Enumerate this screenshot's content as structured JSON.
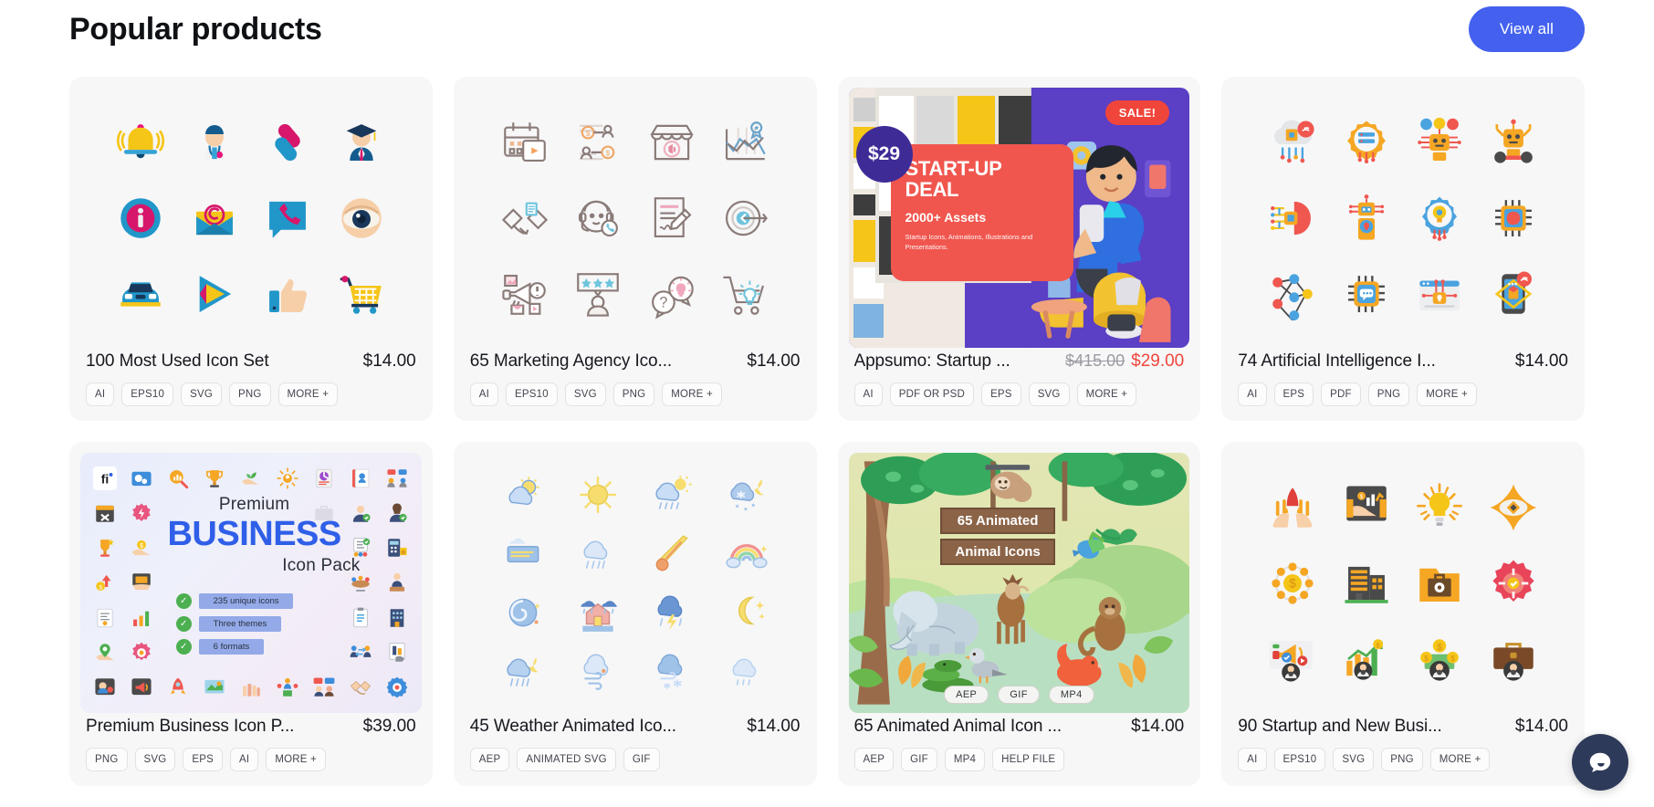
{
  "header": {
    "title": "Popular products",
    "view_all_label": "View all",
    "accent_color": "#4361ee"
  },
  "products": [
    {
      "title": "100 Most Used Icon Set",
      "price": "$14.00",
      "tags": [
        "AI",
        "EPS10",
        "SVG",
        "PNG",
        "MORE +"
      ],
      "thumb_kind": "icon-sheet-flat",
      "icons": [
        "bell-icon",
        "doctor-icon",
        "link-icon",
        "graduate-icon",
        "info-icon",
        "email-icon",
        "phone-chat-icon",
        "eye-icon",
        "car-icon",
        "play-icon",
        "thumbs-up-icon",
        "shopping-cart-icon"
      ]
    },
    {
      "title": "65 Marketing Agency Ico...",
      "price": "$14.00",
      "tags": [
        "AI",
        "EPS10",
        "SVG",
        "PNG",
        "MORE +"
      ],
      "thumb_kind": "icon-sheet-line",
      "icons": [
        "calendar-video-icon",
        "money-network-icon",
        "shop-megaphone-icon",
        "chart-award-icon",
        "handshake-icon",
        "headset-support-icon",
        "contract-pencil-icon",
        "target-arrow-icon",
        "megaphone-media-icon",
        "review-stars-icon",
        "question-idea-icon",
        "cart-idea-icon"
      ]
    },
    {
      "title": "Appsumo: Startup ...",
      "price_old": "$415.00",
      "price_new": "$29.00",
      "tags": [
        "AI",
        "PDF OR PSD",
        "EPS",
        "SVG",
        "MORE +"
      ],
      "thumb_kind": "appsumo-banner",
      "banner": {
        "price_badge": "$29",
        "sale_badge": "SALE!",
        "headline": "START-UP DEAL",
        "subhead": "2000+ Assets",
        "description": "Startup Icons, Animations, Illustrations and Presentations."
      }
    },
    {
      "title": "74 Artificial Intelligence I...",
      "price": "$14.00",
      "tags": [
        "AI",
        "EPS",
        "PDF",
        "PNG",
        "MORE +"
      ],
      "thumb_kind": "icon-sheet-ai",
      "icons": [
        "cloud-chip-icon",
        "gear-server-icon",
        "robot-emotions-icon",
        "robot-wheels-icon",
        "brain-circuit-icon",
        "robot-mobile-icon",
        "gear-bulb-icon",
        "chip-brain-icon",
        "neural-network-icon",
        "chip-chat-icon",
        "browser-lock-circuit-icon",
        "phone-ar-icon"
      ]
    },
    {
      "title": "Premium Business Icon P...",
      "price": "$39.00",
      "tags": [
        "PNG",
        "SVG",
        "EPS",
        "AI",
        "MORE +"
      ],
      "thumb_kind": "premium-business",
      "overlay": {
        "line1": "Premium",
        "line2": "BUSINESS",
        "line3": "Icon Pack",
        "features": [
          "235 unique icons",
          "Three themes",
          "6 formats"
        ]
      }
    },
    {
      "title": "45 Weather Animated Ico...",
      "price": "$14.00",
      "tags": [
        "AEP",
        "ANIMATED SVG",
        "GIF"
      ],
      "thumb_kind": "icon-sheet-weather",
      "icons": [
        "sun-cloud-icon",
        "sun-icon",
        "rain-sun-icon",
        "snow-moon-icon",
        "fog-icon",
        "rain-cloud-icon",
        "meteor-icon",
        "rainbow-icon",
        "hurricane-icon",
        "flood-house-icon",
        "thunderstorm-icon",
        "moon-stars-icon",
        "rain-moon-icon",
        "wind-cloud-icon",
        "snow-wind-icon",
        "drizzle-icon"
      ]
    },
    {
      "title": "65 Animated Animal Icon ...",
      "price": "$14.00",
      "tags": [
        "AEP",
        "GIF",
        "MP4",
        "HELP FILE"
      ],
      "thumb_kind": "jungle-banner",
      "banner": {
        "line1": "65 Animated",
        "line2": "Animal Icons",
        "badges": [
          "AEP",
          "GIF",
          "MP4"
        ]
      }
    },
    {
      "title": "90 Startup and New Busi...",
      "price": "$14.00",
      "tags": [
        "AI",
        "EPS10",
        "SVG",
        "PNG",
        "MORE +"
      ],
      "thumb_kind": "icon-sheet-startup",
      "icons": [
        "rocket-hands-icon",
        "handshake-growth-icon",
        "lightbulb-icon",
        "vision-diamond-icon",
        "coin-dollar-icon",
        "office-building-icon",
        "briefcase-folder-icon",
        "target-badge-icon",
        "marketing-megaphone-icon",
        "growth-chart-icon",
        "money-user-icon",
        "briefcase-icon"
      ]
    }
  ],
  "chat": {
    "icon": "chat-bubble-icon"
  }
}
